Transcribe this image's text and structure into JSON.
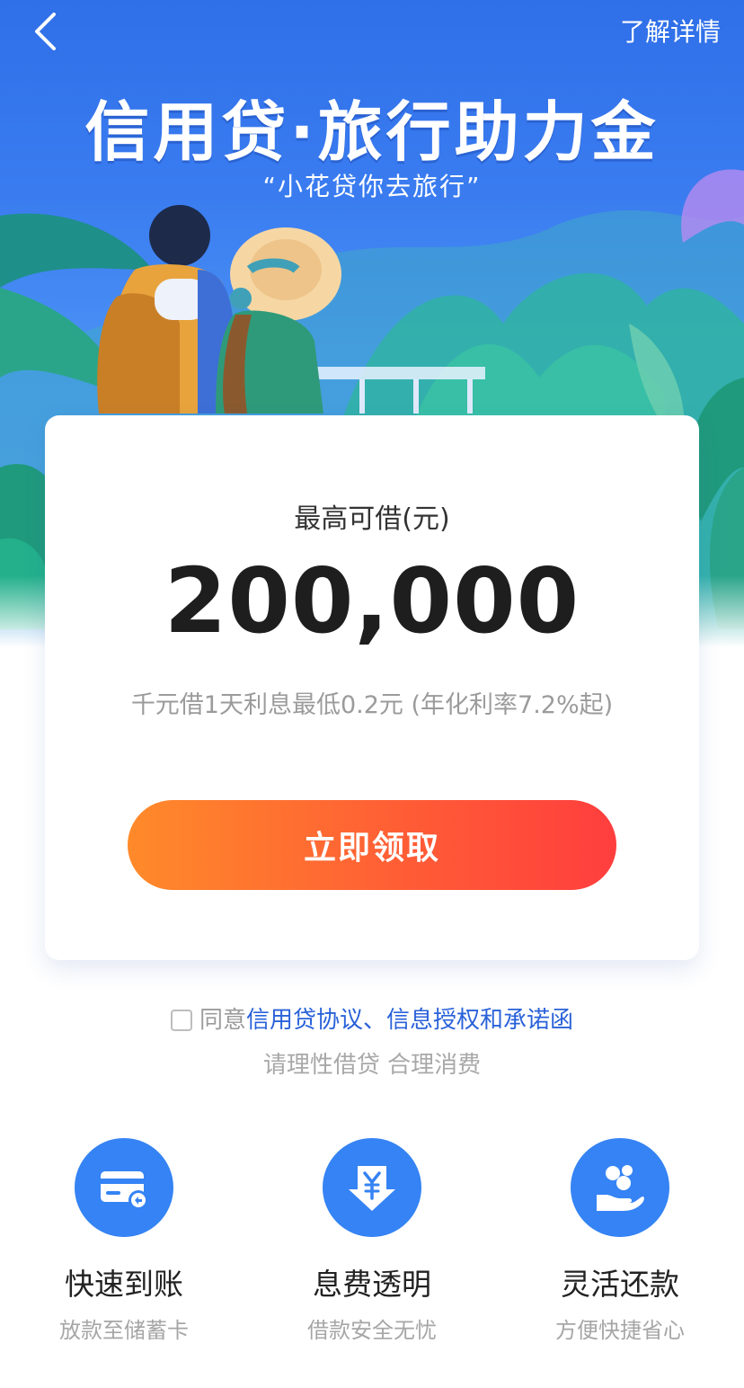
{
  "header": {
    "detail_link": "了解详情"
  },
  "hero": {
    "title": "信用贷·旅行助力金",
    "subtitle": "“小花贷你去旅行”"
  },
  "card": {
    "label": "最高可借(元)",
    "amount": "200,000",
    "rate_text": "千元借1天利息最低0.2元 (年化利率7.2%起)",
    "button_label": "立即领取"
  },
  "agreement": {
    "prefix": "同意",
    "link_text": "信用贷协议、信息授权和承诺函",
    "checked": false
  },
  "reminder": "请理性借贷 合理消费",
  "features": [
    {
      "icon": "card-icon",
      "title": "快速到账",
      "desc": "放款至储蓄卡"
    },
    {
      "icon": "yuan-down-icon",
      "title": "息费透明",
      "desc": "借款安全无忧"
    },
    {
      "icon": "hand-coins-icon",
      "title": "灵活还款",
      "desc": "方便快捷省心"
    }
  ],
  "colors": {
    "hero_blue": "#3a7cf0",
    "button_start": "#ff8a2a",
    "button_end": "#ff3e3e",
    "link_blue": "#2a62d9",
    "feature_icon_bg": "#3583f4"
  }
}
